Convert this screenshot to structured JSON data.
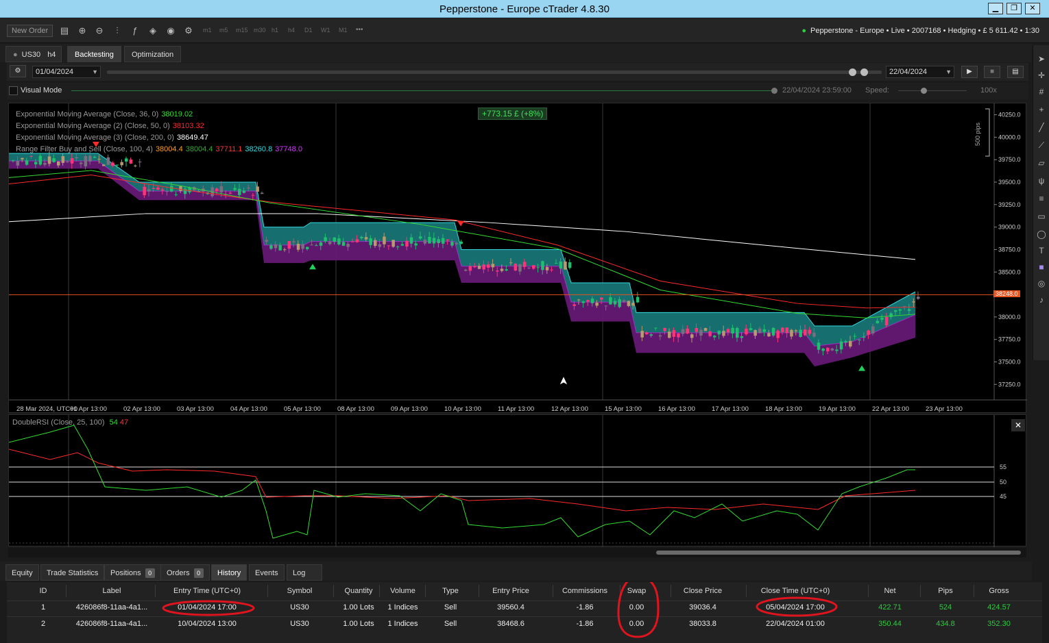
{
  "window": {
    "title": "Pepperstone - Europe cTrader 4.8.30",
    "min": "▁",
    "restore": "❐",
    "close": "✕"
  },
  "toolbar": {
    "new_order": "New Order",
    "timeframes": [
      "m1",
      "m5",
      "m15",
      "m30",
      "h1",
      "h4",
      "D1",
      "W1",
      "M1"
    ],
    "more": "•••",
    "account": "Pepperstone - Europe • Live • 2007168 • Hedging • £ 5 611.42 • 1:30"
  },
  "tabs": {
    "symbol": "US30",
    "timeframe": "h4",
    "backtesting": "Backtesting",
    "optimization": "Optimization"
  },
  "backtest": {
    "start_date": "01/04/2024",
    "end_date": "22/04/2024",
    "visual_mode": "Visual Mode",
    "current_time": "22/04/2024 23:59:00",
    "speed_label": "Speed:",
    "speed_value": "100x"
  },
  "chart": {
    "profit_badge": "+773.15 £ (+8%)",
    "pips_scale": "500 pips",
    "current_price": "38248.0",
    "legend": [
      {
        "label": "Exponential Moving Average (Close, 36, 0)",
        "values": [
          {
            "v": "38019.02",
            "color": "#33dd33"
          }
        ]
      },
      {
        "label": "Exponential Moving Average (2) (Close, 50, 0)",
        "values": [
          {
            "v": "38103.32",
            "color": "#ff2a2a"
          }
        ]
      },
      {
        "label": "Exponential Moving Average (3) (Close, 200, 0)",
        "values": [
          {
            "v": "38649.47",
            "color": "#ffffff"
          }
        ]
      },
      {
        "label": "Range Filter Buy and Sell (Close, 100, 4)",
        "values": [
          {
            "v": "38004.4",
            "color": "#ff9f1a"
          },
          {
            "v": "38004.4",
            "color": "#33aa33"
          },
          {
            "v": "37711.1",
            "color": "#ff3333"
          },
          {
            "v": "38260.8",
            "color": "#33d9e0"
          },
          {
            "v": "37748.0",
            "color": "#d633ff"
          }
        ]
      }
    ],
    "y_ticks": [
      "40250.0",
      "40000.0",
      "39750.0",
      "39500.0",
      "39250.0",
      "39000.0",
      "38750.0",
      "38500.0",
      "38000.0",
      "37750.0",
      "37500.0",
      "37250.0"
    ],
    "x_ticks": [
      "28 Mar 2024, UTC+0",
      "01 Apr 13:00",
      "02 Apr 13:00",
      "03 Apr 13:00",
      "04 Apr 13:00",
      "05 Apr 13:00",
      "08 Apr 13:00",
      "09 Apr 13:00",
      "10 Apr 13:00",
      "11 Apr 13:00",
      "12 Apr 13:00",
      "15 Apr 13:00",
      "16 Apr 13:00",
      "17 Apr 13:00",
      "18 Apr 13:00",
      "19 Apr 13:00",
      "22 Apr 13:00",
      "23 Apr 13:00"
    ]
  },
  "rsi": {
    "label": "DoubleRSI (Close, 25, 100)",
    "v1": "54",
    "v2": "47",
    "levels": [
      "55",
      "50",
      "45"
    ],
    "close": "✕"
  },
  "bottom_tabs": [
    {
      "label": "Equity",
      "badge": ""
    },
    {
      "label": "Trade Statistics",
      "badge": ""
    },
    {
      "label": "Positions",
      "badge": "0"
    },
    {
      "label": "Orders",
      "badge": "0"
    },
    {
      "label": "History",
      "badge": ""
    },
    {
      "label": "Events",
      "badge": ""
    },
    {
      "label": "Log",
      "badge": ""
    }
  ],
  "history": {
    "columns": [
      "ID",
      "Label",
      "Entry Time (UTC+0)",
      "Symbol",
      "Quantity",
      "Volume",
      "Type",
      "Entry Price",
      "Commissions",
      "Swap",
      "Close Price",
      "Close Time (UTC+0)",
      "Net",
      "Pips",
      "Gross"
    ],
    "rows": [
      [
        "1",
        "426086f8-11aa-4a1...",
        "01/04/2024 17:00",
        "US30",
        "1.00 Lots",
        "1 Indices",
        "Sell",
        "39560.4",
        "-1.86",
        "0.00",
        "39036.4",
        "05/04/2024 17:00",
        "422.71",
        "524",
        "424.57"
      ],
      [
        "2",
        "426086f8-11aa-4a1...",
        "10/04/2024 13:00",
        "US30",
        "1.00 Lots",
        "1 Indices",
        "Sell",
        "38468.6",
        "-1.86",
        "0.00",
        "38033.8",
        "22/04/2024 01:00",
        "350.44",
        "434.8",
        "352.30"
      ]
    ]
  }
}
